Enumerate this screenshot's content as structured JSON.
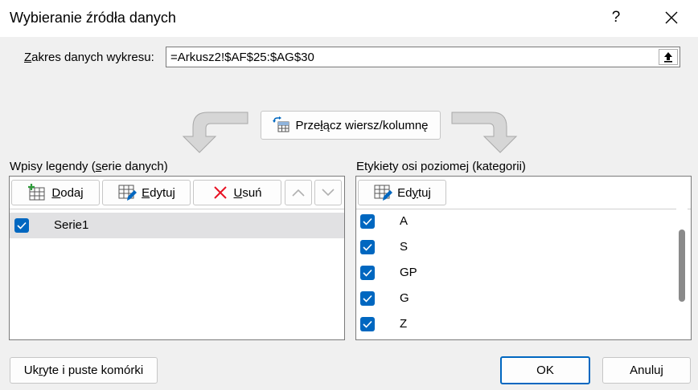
{
  "dialog": {
    "title": "Wybieranie źródła danych",
    "help_label": "?",
    "close_icon": "close-icon"
  },
  "range": {
    "label_underlined": "Z",
    "label_rest": "akres danych wykresu:",
    "value": "=Arkusz2!$AF$25:$AG$30",
    "collapse_icon": "collapse-up-arrow-icon"
  },
  "switch_button": {
    "label_pre": "Prze",
    "label_underlined": "ł",
    "label_post": "ącz wiersz/kolumnę",
    "icon": "switch-row-column-icon"
  },
  "legend": {
    "header_pre": "Wpisy legendy (",
    "header_underlined": "s",
    "header_post": "erie danych)",
    "toolbar": {
      "add": {
        "underlined": "D",
        "rest": "odaj",
        "icon": "add-table-icon"
      },
      "edit": {
        "underlined": "E",
        "rest": "dytuj",
        "icon": "edit-table-icon"
      },
      "remove": {
        "underlined": "U",
        "rest": "suń",
        "icon": "red-x-icon"
      },
      "move_up_icon": "chevron-up-icon",
      "move_down_icon": "chevron-down-icon"
    },
    "items": [
      {
        "label": "Serie1",
        "checked": true,
        "selected": true
      }
    ]
  },
  "axis": {
    "header": "Etykiety osi poziomej (kategorii)",
    "toolbar": {
      "edit": {
        "pre": "Ed",
        "underlined": "y",
        "rest": "tuj",
        "icon": "edit-table-icon"
      }
    },
    "items": [
      {
        "label": "A",
        "checked": true
      },
      {
        "label": "S",
        "checked": true
      },
      {
        "label": "GP",
        "checked": true
      },
      {
        "label": "G",
        "checked": true
      },
      {
        "label": "Z",
        "checked": true
      }
    ]
  },
  "footer": {
    "hidden_cells": {
      "pre": "Uk",
      "underlined": "r",
      "rest": "yte i puste komórki"
    },
    "ok_label": "OK",
    "cancel_label": "Anuluj"
  },
  "colors": {
    "accent": "#0067c0",
    "selected_row": "#e1e1e3",
    "dialog_bg": "#f0f0f0",
    "remove_icon": "#e81123"
  }
}
